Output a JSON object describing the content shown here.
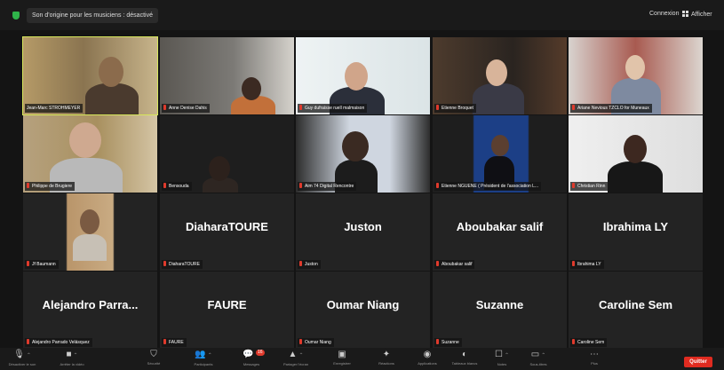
{
  "topbar": {
    "meeting_label": "Son d'origine pour les musiciens : désactivé",
    "connexion": "Connexion",
    "afficher": "Afficher"
  },
  "participants": [
    {
      "caption": "Jean-Marc STROHMEYER",
      "video": true,
      "active": true
    },
    {
      "caption": "Anne Denise Dahis",
      "video": true
    },
    {
      "caption": "Guy dufraisse ruell malmaison",
      "video": true
    },
    {
      "caption": "Etienne Broquet",
      "video": true
    },
    {
      "caption": "Ariane Nevious TZCLO for Muneaux",
      "video": true
    },
    {
      "caption": "Philippe de Brugiere",
      "video": true
    },
    {
      "caption": "Bensouda",
      "video": true
    },
    {
      "caption": "Aim 74 Digital Rencontre",
      "video": true
    },
    {
      "caption": "Etienne NGUENE ( Président de l'association L...",
      "video": true
    },
    {
      "caption": "Christian Rinn",
      "video": true
    },
    {
      "caption": "Jf Baumann",
      "video": true
    },
    {
      "name": "DiaharaTOURE",
      "caption": "DiaharaTOURE",
      "video": false
    },
    {
      "name": "Juston",
      "caption": "Juston",
      "video": false
    },
    {
      "name": "Aboubakar salif",
      "caption": "Aboubakar salif",
      "video": false
    },
    {
      "name": "Ibrahima LY",
      "caption": "Ibrahima LY",
      "video": false
    },
    {
      "name": "Alejandro  Parra...",
      "caption": "Alejandro Parrado Velásquez",
      "video": false
    },
    {
      "name": "FAURE",
      "caption": "FAURE",
      "video": false
    },
    {
      "name": "Oumar Niang",
      "caption": "Oumar Niang",
      "video": false
    },
    {
      "name": "Suzanne",
      "caption": "Suzanne",
      "video": false
    },
    {
      "name": "Caroline Sem",
      "caption": "Caroline Sem",
      "video": false
    }
  ],
  "toolbar": {
    "items": [
      {
        "icon": "microphone-icon",
        "glyph": "🎙",
        "label": "Désactiver le son",
        "caret": true
      },
      {
        "icon": "camera-icon",
        "glyph": "■",
        "label": "Arrêter la vidéo",
        "caret": true
      },
      {
        "icon": "security-icon",
        "glyph": "⛉",
        "label": "Sécurité",
        "caret": false
      },
      {
        "icon": "participants-icon",
        "glyph": "👥",
        "label": "Participants",
        "caret": true
      },
      {
        "icon": "chat-icon",
        "glyph": "💬",
        "label": "Messages",
        "caret": true
      },
      {
        "icon": "share-screen-icon",
        "glyph": "▲",
        "label": "Partager l'écran",
        "caret": true
      },
      {
        "icon": "record-icon",
        "glyph": "▣",
        "label": "Enregistrer",
        "caret": false
      },
      {
        "icon": "reactions-icon",
        "glyph": "✦",
        "label": "Réactions",
        "caret": false
      },
      {
        "icon": "apps-icon",
        "glyph": "◉",
        "label": "Applications",
        "caret": false
      },
      {
        "icon": "whiteboard-icon",
        "glyph": "◐",
        "label": "Tableaux blancs",
        "caret": false
      },
      {
        "icon": "notes-icon",
        "glyph": "☐",
        "label": "Notes",
        "caret": true
      },
      {
        "icon": "captions-icon",
        "glyph": "▭",
        "label": "Sous-titres",
        "caret": true
      },
      {
        "icon": "more-icon",
        "glyph": "⋯",
        "label": "Plus",
        "caret": false
      }
    ],
    "chat_badge": "16",
    "quit_label": "Quitter"
  },
  "colors": {
    "active_outline": "#d7e75b",
    "mute_red": "#e03a2c",
    "quit_red": "#e02b20",
    "tile_bg": "#232323"
  }
}
